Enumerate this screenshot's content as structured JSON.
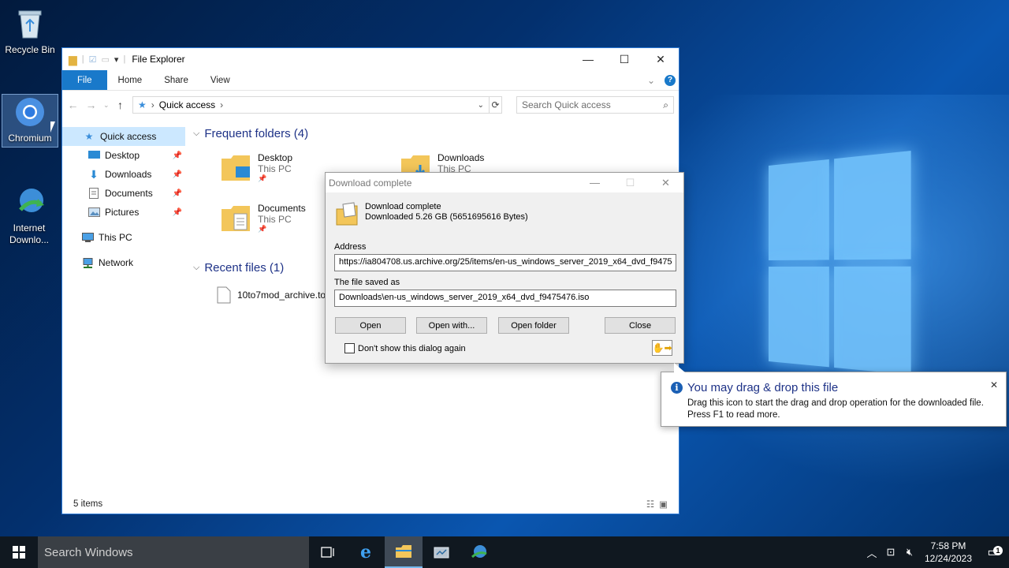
{
  "desktop": {
    "icons": [
      {
        "label": "Recycle Bin",
        "icon": "recycle-bin-icon"
      },
      {
        "label": "Chromium",
        "icon": "chromium-icon"
      },
      {
        "label": "Internet Downlo...",
        "icon": "internet-download-manager-icon"
      }
    ]
  },
  "explorer": {
    "title": "File Explorer",
    "window_controls": {
      "minimize": "—",
      "maximize": "☐",
      "close": "✕"
    },
    "ribbon_tabs": [
      "File",
      "Home",
      "Share",
      "View"
    ],
    "address": {
      "location": "Quick access"
    },
    "search_placeholder": "Search Quick access",
    "nav": [
      {
        "label": "Quick access",
        "icon": "star-icon",
        "pinned": false,
        "active": true
      },
      {
        "label": "Desktop",
        "icon": "desktop-icon",
        "pinned": true
      },
      {
        "label": "Downloads",
        "icon": "download-arrow-icon",
        "pinned": true
      },
      {
        "label": "Documents",
        "icon": "document-icon",
        "pinned": true
      },
      {
        "label": "Pictures",
        "icon": "pictures-icon",
        "pinned": true
      },
      {
        "label": "This PC",
        "icon": "computer-icon",
        "pinned": false
      },
      {
        "label": "Network",
        "icon": "network-icon",
        "pinned": false
      }
    ],
    "frequent_header": "Frequent folders (4)",
    "frequent": [
      {
        "name": "Desktop",
        "location": "This PC"
      },
      {
        "name": "Downloads",
        "location": "This PC"
      },
      {
        "name": "Documents",
        "location": "This PC"
      }
    ],
    "recent_header": "Recent files (1)",
    "recent": [
      {
        "name": "10to7mod_archive.to"
      }
    ],
    "status": "5 items"
  },
  "dialog": {
    "title": "Download complete",
    "heading": "Download complete",
    "subheading": "Downloaded 5.26  GB (5651695616 Bytes)",
    "address_label": "Address",
    "address_value": "https://ia804708.us.archive.org/25/items/en-us_windows_server_2019_x64_dvd_f9475",
    "saved_label": "The file saved as",
    "saved_value": "Downloads\\en-us_windows_server_2019_x64_dvd_f9475476.iso",
    "buttons": {
      "open": "Open",
      "open_with": "Open with...",
      "open_folder": "Open folder",
      "close": "Close"
    },
    "checkbox_label": "Don't show this dialog again"
  },
  "balloon": {
    "title": "You may drag & drop this file",
    "line1": "Drag this icon to start the drag and drop operation for the downloaded file.",
    "line2": "Press F1 to read more.",
    "close": "✕"
  },
  "taskbar": {
    "search_placeholder": "Search Windows",
    "time": "7:58 PM",
    "date": "12/24/2023",
    "notification_count": "1"
  }
}
